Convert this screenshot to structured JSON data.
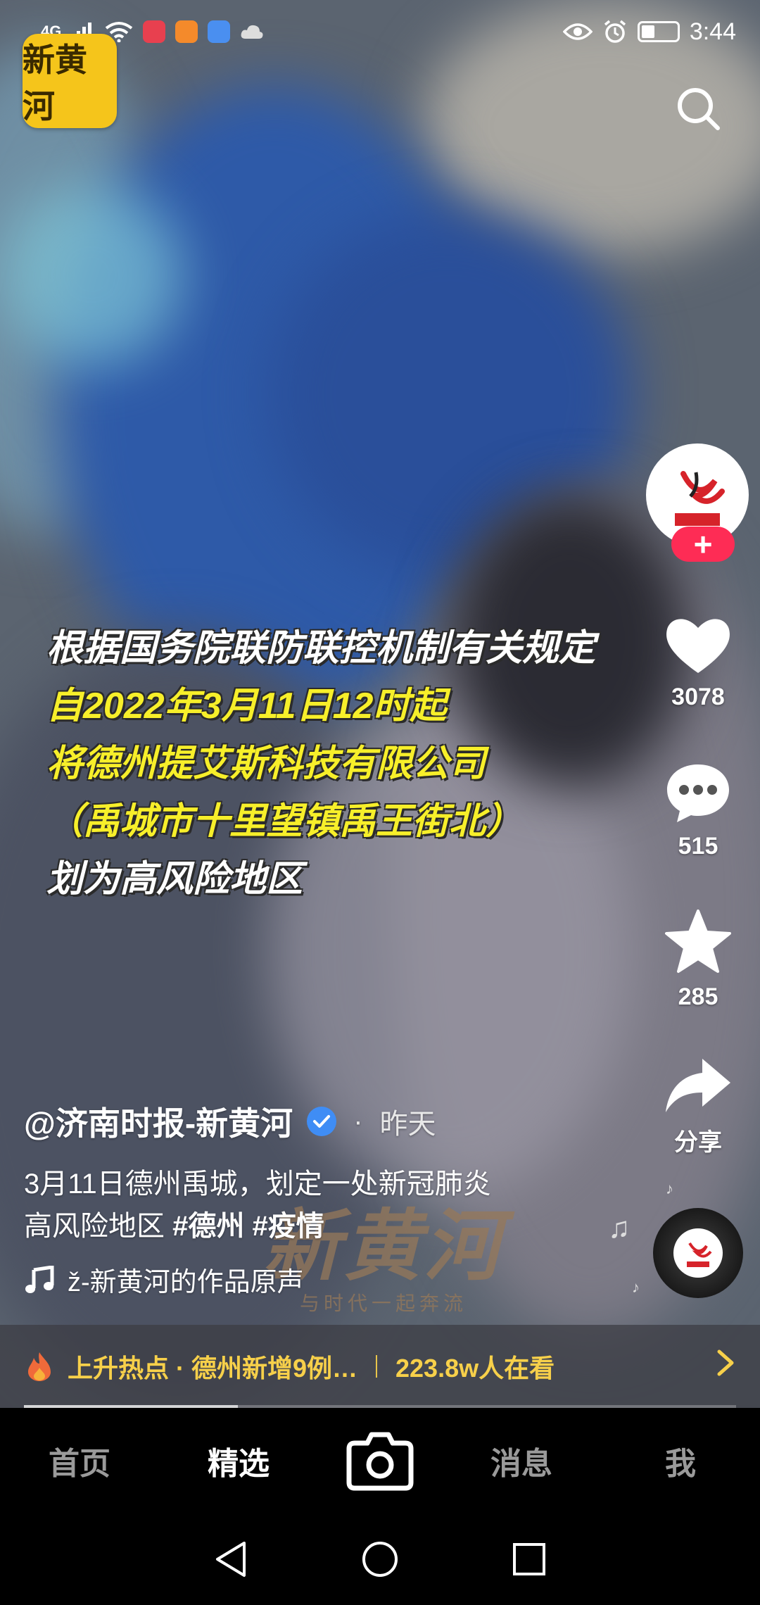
{
  "status_bar": {
    "network": "4G",
    "time": "3:44"
  },
  "app_logo": {
    "text": "新黄河"
  },
  "video_caption": {
    "lines": [
      "根据国务院联防联控机制有关规定",
      "自2022年3月11日12时起",
      "将德州提艾斯科技有限公司",
      "（禹城市十里望镇禹王街北）",
      "划为高风险地区"
    ]
  },
  "right_rail": {
    "follow_symbol": "+",
    "likes": "3078",
    "comments": "515",
    "favorites": "285",
    "share_label": "分享"
  },
  "post": {
    "author": "@济南时报-新黄河",
    "dot": "·",
    "time": "昨天",
    "description_line1": "3月11日德州禹城，划定一处新冠肺炎",
    "description_line2": "高风险地区",
    "tags": [
      "#德州",
      "#疫情"
    ],
    "music": "ž-新黄河的作品原声"
  },
  "watermark": {
    "big": "新黄河",
    "small": "与时代一起奔流"
  },
  "hot_bar": {
    "topic": "上升热点 · 德州新增9例…",
    "viewers": "223.8w人在看"
  },
  "bottom_nav": {
    "items": [
      "首页",
      "精选",
      "消息",
      "我"
    ]
  },
  "colors": {
    "follow_red": "#fe2c55",
    "caption_yellow": "#f7ef2a",
    "hot_yellow": "#f7d04a",
    "verified_blue": "#3f8df5",
    "logo_yellow": "#f5c51b"
  },
  "progress": 0.3
}
